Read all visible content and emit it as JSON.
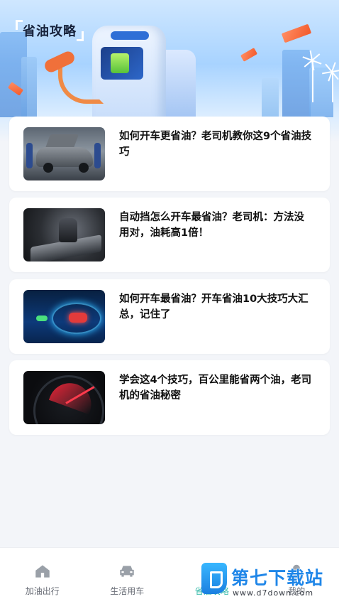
{
  "header": {
    "title": "省油攻略"
  },
  "articles": [
    {
      "title": "如何开车更省油？老司机教你这9个省油技巧",
      "thumbnail": "car-repair-garage"
    },
    {
      "title": "自动挡怎么开车最省油？老司机：方法没用对，油耗高1倍！",
      "thumbnail": "gear-shifter"
    },
    {
      "title": "如何开车最省油？开车省油10大技巧大汇总，记住了",
      "thumbnail": "night-driving-car"
    },
    {
      "title": "学会这4个技巧，百公里能省两个油，老司机的省油秘密",
      "thumbnail": "speedometer"
    }
  ],
  "bottom_nav": {
    "items": [
      {
        "label": "加油出行",
        "icon": "home-icon",
        "active": false
      },
      {
        "label": "生活用车",
        "icon": "car-icon",
        "active": false
      },
      {
        "label": "省油攻略",
        "icon": "guide-icon",
        "active": true
      },
      {
        "label": "我的",
        "icon": "profile-icon",
        "active": false
      }
    ]
  },
  "watermark": {
    "name": "第七下载站",
    "url": "www.d7down.com"
  },
  "colors": {
    "accent": "#2fb7a6",
    "background": "#f3f5f9",
    "card": "#ffffff"
  }
}
